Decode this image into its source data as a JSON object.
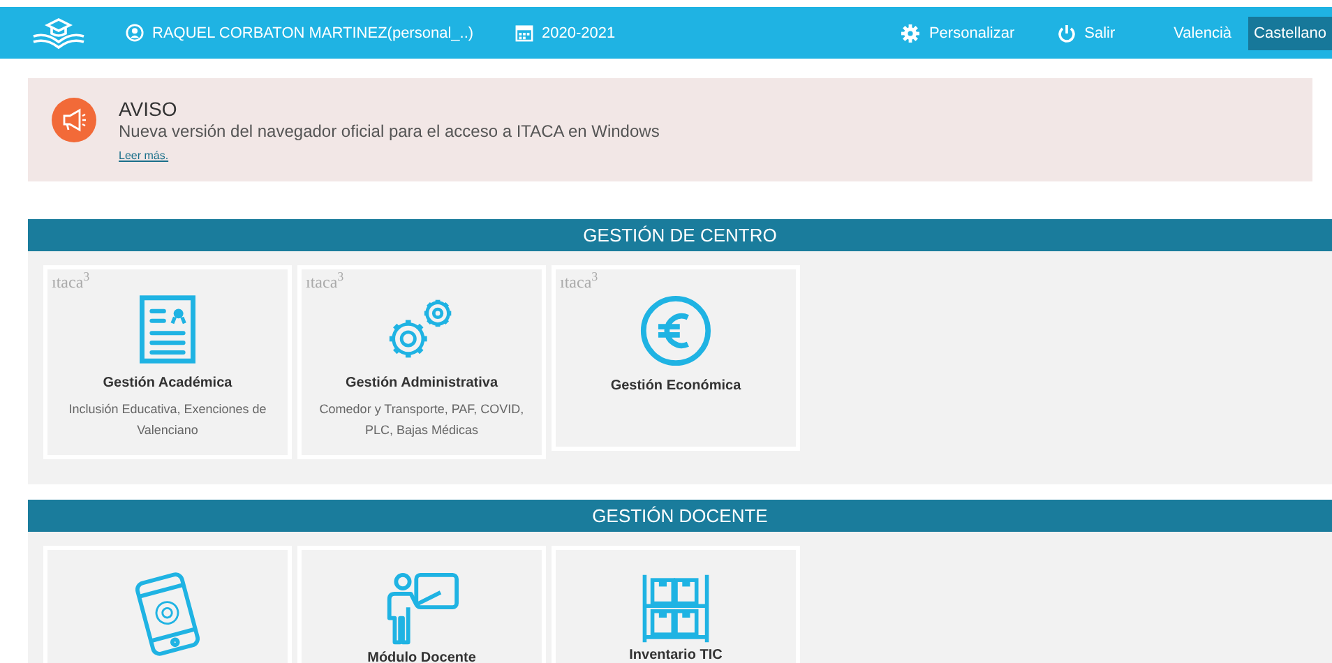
{
  "top_bar": {
    "user": "RAQUEL CORBATON MARTINEZ(personal_..)",
    "year": "2020-2021",
    "actions": [
      {
        "kind": "settings",
        "label": "Personalizar"
      },
      {
        "kind": "logout",
        "label": "Salir"
      }
    ],
    "languages": [
      {
        "label": "Valencià",
        "selected": false
      },
      {
        "label": "Castellano",
        "selected": true
      }
    ]
  },
  "notice": {
    "title": "AVISO",
    "message": "Nueva versión del navegador oficial para el acceso a ITACA en Windows",
    "link": "Leer más."
  },
  "sections": [
    {
      "title": "GESTIÓN DE CENTRO",
      "cards": [
        {
          "kind": "document",
          "brand": "ıtaca",
          "brand_sup": "3",
          "title": "Gestión Académica",
          "description": "Inclusión Educativa, Exenciones de Valenciano"
        },
        {
          "kind": "gears",
          "brand": "ıtaca",
          "brand_sup": "3",
          "title": "Gestión Administrativa",
          "description": "Comedor y Transporte, PAF, COVID, PLC, Bajas Médicas"
        },
        {
          "kind": "euro",
          "brand": "ıtaca",
          "brand_sup": "3",
          "title": "Gestión Económica"
        }
      ]
    },
    {
      "title": "GESTIÓN DOCENTE",
      "cards": [
        {
          "kind": "tablet"
        },
        {
          "kind": "teacher",
          "title": "Módulo Docente"
        },
        {
          "kind": "shelf",
          "title": "Inventario TIC"
        }
      ]
    }
  ]
}
